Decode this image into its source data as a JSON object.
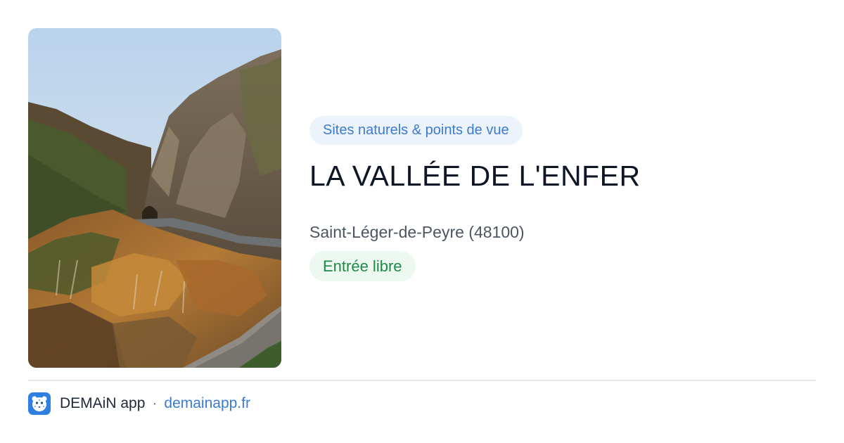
{
  "card": {
    "image": {
      "alt": "Gorge valley with autumn trees, rocky cliffs and a winding road"
    },
    "category": "Sites naturels & points de vue",
    "title": "LA VALLÉE DE L'ENFER",
    "location": "Saint-Léger-de-Peyre (48100)",
    "access": "Entrée libre"
  },
  "footer": {
    "icon": "app-logo-icon",
    "app_name": "DEMAiN app",
    "separator": "·",
    "domain": "demainapp.fr"
  },
  "colors": {
    "category_badge_bg": "#edf3fb",
    "category_badge_text": "#3b7bd1",
    "access_badge_bg": "#ecf8f0",
    "access_badge_text": "#1e8a46",
    "title": "#0f1726",
    "link": "#3b7bd1",
    "app_icon": "#2f7fe0"
  }
}
